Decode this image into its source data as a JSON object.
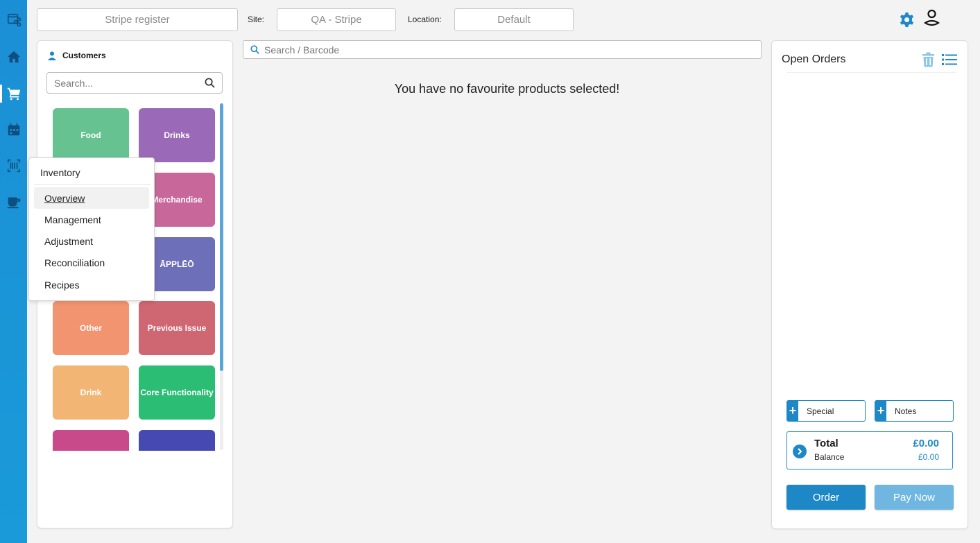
{
  "topbar": {
    "register": "Stripe register",
    "site_label": "Site:",
    "site_value": "QA - Stripe",
    "location_label": "Location:",
    "location_value": "Default"
  },
  "nav": {
    "icons": [
      "app-logo-icon",
      "home-icon",
      "cart-icon",
      "calendar-icon",
      "barcode-icon",
      "coffee-cup-icon"
    ],
    "active": "cart-icon"
  },
  "customers": {
    "title": "Customers",
    "search_placeholder": "Search..."
  },
  "categories": [
    {
      "label": "Food",
      "color": "#66c291"
    },
    {
      "label": "Drinks",
      "color": "#9a6ab8"
    },
    {
      "label": "",
      "color": "#6dc0a0"
    },
    {
      "label": "Merchandise",
      "color": "#c7679a"
    },
    {
      "label": "",
      "color": "#7a8cc6"
    },
    {
      "label": "ĀPPLĒŌ",
      "color": "#6e6fb9"
    },
    {
      "label": "Other",
      "color": "#f29470"
    },
    {
      "label": "Previous Issue",
      "color": "#cf6772"
    },
    {
      "label": "Drink",
      "color": "#f2b574"
    },
    {
      "label": "Core Functionality",
      "color": "#2cbd75"
    },
    {
      "label": "",
      "color": "#c94a8a"
    },
    {
      "label": "",
      "color": "#4549b1"
    }
  ],
  "popup": {
    "title": "Inventory",
    "items": [
      "Overview",
      "Management",
      "Adjustment",
      "Reconciliation",
      "Recipes"
    ]
  },
  "main": {
    "search_placeholder": "Search / Barcode",
    "empty_message": "You have no favourite products selected!"
  },
  "orders": {
    "title": "Open Orders",
    "special_label": "Special",
    "notes_label": "Notes",
    "total_label": "Total",
    "total_value": "£0.00",
    "balance_label": "Balance",
    "balance_value": "£0.00",
    "order_button": "Order",
    "pay_button": "Pay Now"
  },
  "colors": {
    "accent": "#1e88c7",
    "rail": "#1b8fd6",
    "pay_disabled": "#6fb6e0"
  }
}
